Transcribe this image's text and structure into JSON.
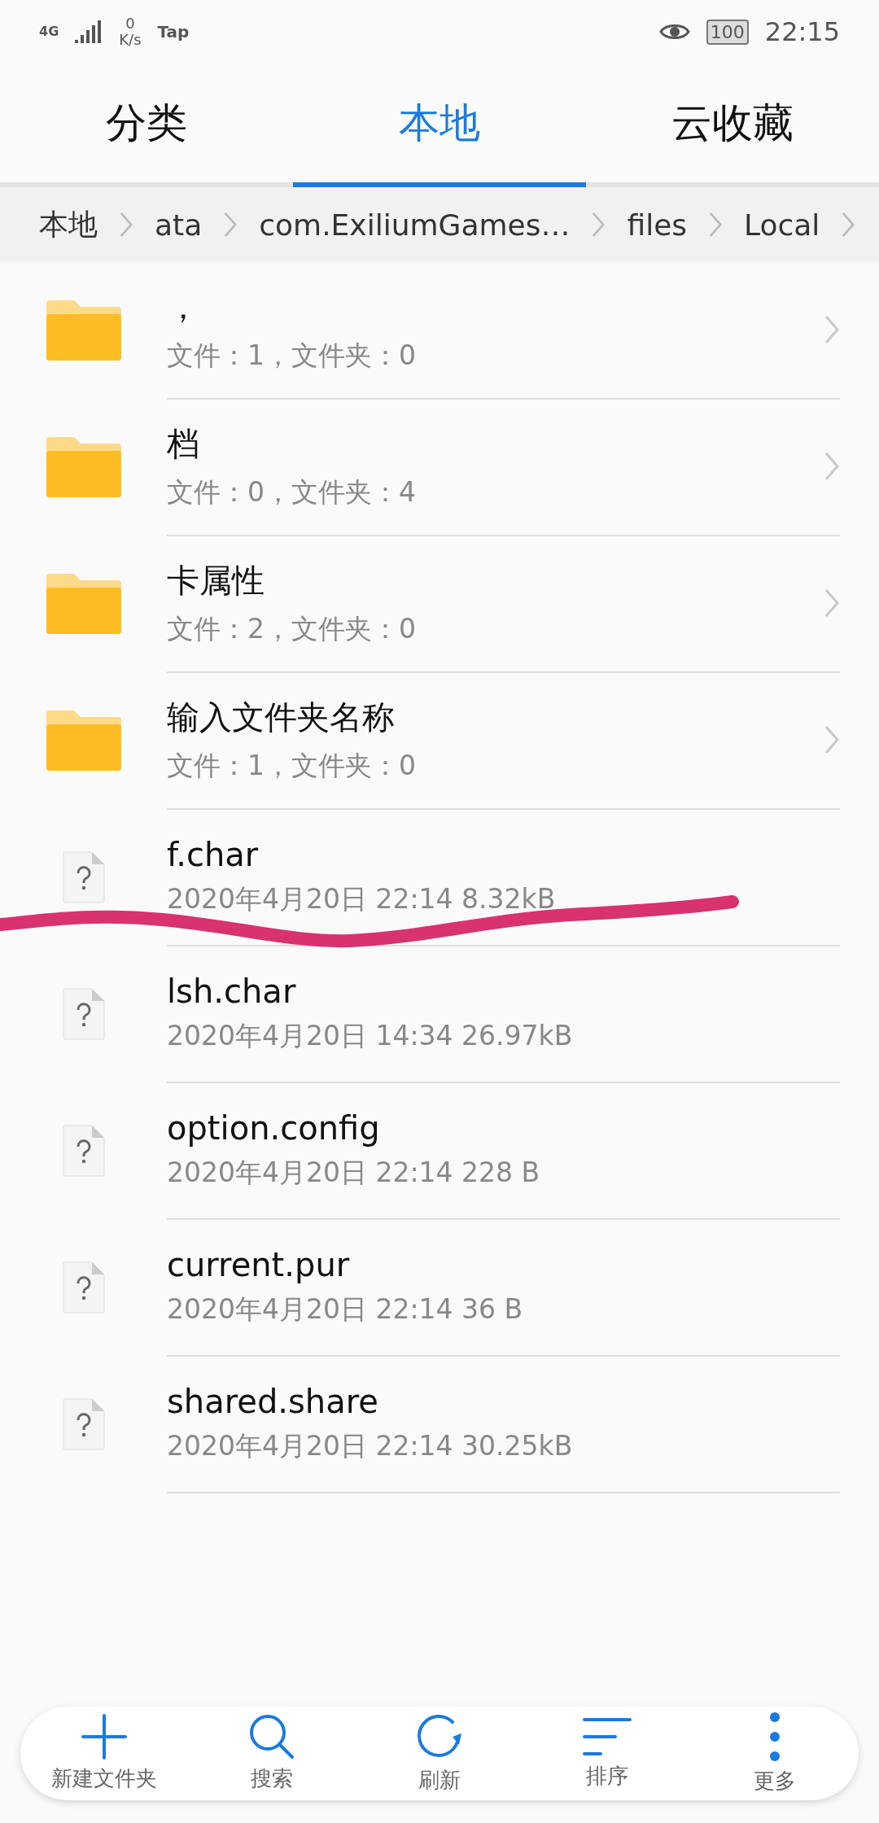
{
  "status_bar": {
    "network": "4G",
    "speed": "0",
    "speed_unit": "K/s",
    "carrier": "Tap",
    "battery": "100",
    "time": "22:15"
  },
  "tabs": [
    {
      "label": "分类",
      "selected": false
    },
    {
      "label": "本地",
      "selected": true
    },
    {
      "label": "云收藏",
      "selected": false
    }
  ],
  "breadcrumb": [
    "本地",
    "ata",
    "com.ExiliumGames…",
    "files",
    "Local"
  ],
  "items": [
    {
      "kind": "folder",
      "name": "，",
      "details": "文件：1，文件夹：0"
    },
    {
      "kind": "folder",
      "name": "档",
      "details": "文件：0，文件夹：4"
    },
    {
      "kind": "folder",
      "name": "卡属性",
      "details": "文件：2，文件夹：0"
    },
    {
      "kind": "folder",
      "name": "输入文件夹名称",
      "details": "文件：1，文件夹：0"
    },
    {
      "kind": "file",
      "name": "f.char",
      "details": "2020年4月20日 22:14 8.32kB"
    },
    {
      "kind": "file",
      "name": "lsh.char",
      "details": "2020年4月20日 14:34 26.97kB"
    },
    {
      "kind": "file",
      "name": "option.config",
      "details": "2020年4月20日 22:14 228 B"
    },
    {
      "kind": "file",
      "name": "current.pur",
      "details": "2020年4月20日 22:14 36 B"
    },
    {
      "kind": "file",
      "name": "shared.share",
      "details": "2020年4月20日 22:14 30.25kB"
    }
  ],
  "toolbar": [
    {
      "kind": "add",
      "label": "新建文件夹"
    },
    {
      "kind": "search",
      "label": "搜索"
    },
    {
      "kind": "refresh",
      "label": "刷新"
    },
    {
      "kind": "sort",
      "label": "排序"
    },
    {
      "kind": "more",
      "label": "更多"
    }
  ]
}
